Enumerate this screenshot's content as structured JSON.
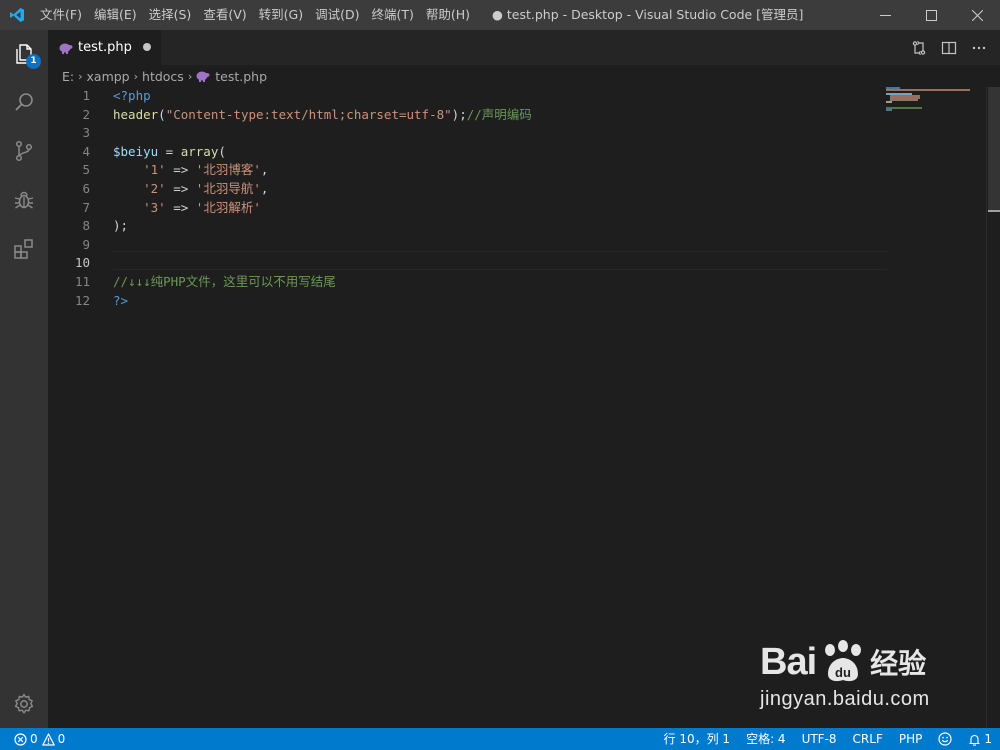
{
  "window": {
    "title": "● test.php - Desktop - Visual Studio Code [管理员]"
  },
  "menu": [
    "文件(F)",
    "编辑(E)",
    "选择(S)",
    "查看(V)",
    "转到(G)",
    "调试(D)",
    "终端(T)",
    "帮助(H)"
  ],
  "activity": {
    "explorer_badge": "1"
  },
  "tab": {
    "label": "test.php"
  },
  "breadcrumb": [
    "E:",
    "xampp",
    "htdocs",
    "test.php"
  ],
  "editor": {
    "line_numbers": [
      "1",
      "2",
      "3",
      "4",
      "5",
      "6",
      "7",
      "8",
      "9",
      "10",
      "11",
      "12"
    ],
    "active_line": "10"
  },
  "code": {
    "l1": "<?php",
    "l2_fn": "header",
    "l2_p1": "(",
    "l2_str": "\"Content-type:text/html;charset=utf-8\"",
    "l2_p2": ");",
    "l2_cmt": "//声明编码",
    "l4_var": "$beiyu",
    "l4_op": " = ",
    "l4_fn": "array",
    "l4_p": "(",
    "l5_k": "'1'",
    "l5_v": "'北羽博客'",
    "l6_k": "'2'",
    "l6_v": "'北羽导航'",
    "l7_k": "'3'",
    "l7_v": "'北羽解析'",
    "arrow": " => ",
    "comma": ",",
    "l8": ");",
    "l11": "//↓↓↓纯PHP文件，这里可以不用写结尾",
    "l12": "?>"
  },
  "watermark": {
    "brand": "Bai",
    "brand2": "经验",
    "url": "jingyan.baidu.com"
  },
  "status": {
    "errors": "0",
    "warnings": "0",
    "position": "行 10，列 1",
    "spaces": "空格: 4",
    "encoding": "UTF-8",
    "eol": "CRLF",
    "language": "PHP",
    "notifications": "1"
  },
  "colors": {
    "statusbar": "#007acc",
    "keyword": "#569cd6",
    "function": "#dcdcaa",
    "string": "#ce9178",
    "comment": "#6a9955",
    "variable": "#9cdcfe"
  }
}
